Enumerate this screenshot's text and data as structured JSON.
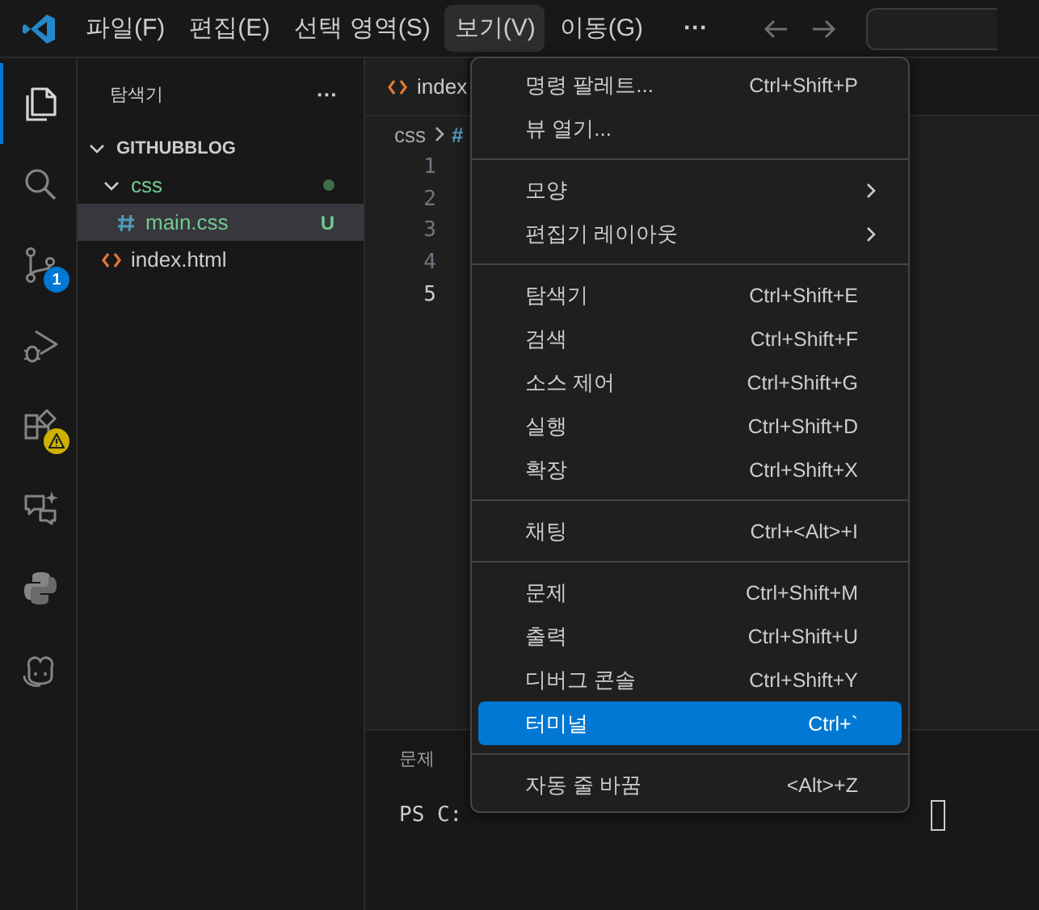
{
  "title_bar": {
    "menus": [
      {
        "label": "파일(F)",
        "selected": false
      },
      {
        "label": "편집(E)",
        "selected": false
      },
      {
        "label": "선택 영역(S)",
        "selected": false
      },
      {
        "label": "보기(V)",
        "selected": true
      },
      {
        "label": "이동(G)",
        "selected": false
      }
    ],
    "more": "···"
  },
  "activity_bar": [
    {
      "kind": "files",
      "selected": true
    },
    {
      "kind": "search",
      "selected": false
    },
    {
      "kind": "source-control",
      "selected": false,
      "badge": "1"
    },
    {
      "kind": "run",
      "selected": false
    },
    {
      "kind": "extensions",
      "selected": false,
      "warning": true
    },
    {
      "kind": "chat",
      "selected": false
    },
    {
      "kind": "python",
      "selected": false
    },
    {
      "kind": "copilot",
      "selected": false
    }
  ],
  "sidebar": {
    "title": "탐색기",
    "more": "···",
    "tree": [
      {
        "label": "GITHUBBLOG",
        "kind": "root",
        "expanded": true,
        "children": [
          {
            "label": "css",
            "kind": "folder",
            "expanded": true,
            "modified": true,
            "children": [
              {
                "label": "main.css",
                "kind": "css",
                "selected": true,
                "status": "U"
              }
            ]
          },
          {
            "label": "index.html",
            "kind": "html",
            "selected": false
          }
        ]
      }
    ]
  },
  "editor": {
    "tab": "index",
    "breadcrumb": "css",
    "breadcrumb_symbol": "#",
    "lines": [
      {
        "number": "1",
        "current": false
      },
      {
        "number": "2",
        "current": false
      },
      {
        "number": "3",
        "current": false
      },
      {
        "number": "4",
        "current": false
      },
      {
        "number": "5",
        "current": true
      }
    ]
  },
  "panel": {
    "tab": "문제",
    "terminal": "PS C:"
  },
  "menu": {
    "items": [
      {
        "kind": "item",
        "label": "명령 팔레트...",
        "shortcut": "Ctrl+Shift+P",
        "selected": false
      },
      {
        "kind": "item",
        "label": "뷰 열기...",
        "selected": false
      },
      {
        "kind": "separator"
      },
      {
        "kind": "submenu",
        "label": "모양",
        "selected": false
      },
      {
        "kind": "submenu",
        "label": "편집기 레이아웃",
        "selected": false
      },
      {
        "kind": "separator"
      },
      {
        "kind": "item",
        "label": "탐색기",
        "shortcut": "Ctrl+Shift+E",
        "selected": false
      },
      {
        "kind": "item",
        "label": "검색",
        "shortcut": "Ctrl+Shift+F",
        "selected": false
      },
      {
        "kind": "item",
        "label": "소스 제어",
        "shortcut": "Ctrl+Shift+G",
        "selected": false
      },
      {
        "kind": "item",
        "label": "실행",
        "shortcut": "Ctrl+Shift+D",
        "selected": false
      },
      {
        "kind": "item",
        "label": "확장",
        "shortcut": "Ctrl+Shift+X",
        "selected": false
      },
      {
        "kind": "separator"
      },
      {
        "kind": "item",
        "label": "채팅",
        "shortcut": "Ctrl+<Alt>+I",
        "selected": false
      },
      {
        "kind": "separator"
      },
      {
        "kind": "item",
        "label": "문제",
        "shortcut": "Ctrl+Shift+M",
        "selected": false
      },
      {
        "kind": "item",
        "label": "출력",
        "shortcut": "Ctrl+Shift+U",
        "selected": false
      },
      {
        "kind": "item",
        "label": "디버그 콘솔",
        "shortcut": "Ctrl+Shift+Y",
        "selected": false
      },
      {
        "kind": "item",
        "label": "터미널",
        "shortcut": "Ctrl+`",
        "selected": true
      },
      {
        "kind": "separator"
      },
      {
        "kind": "item",
        "label": "자동 줄 바꿈",
        "shortcut": "<Alt>+Z",
        "selected": false
      }
    ]
  }
}
